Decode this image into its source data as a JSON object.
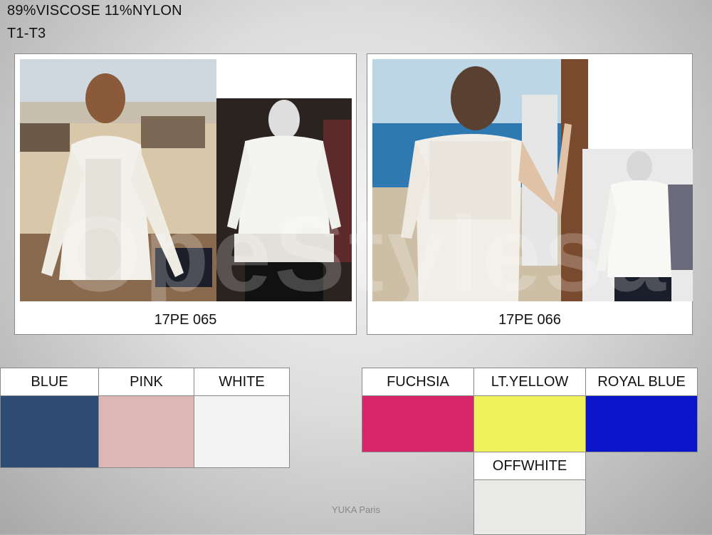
{
  "header": {
    "line1": "89%VISCOSE 11%NYLON",
    "line2": "T1-T3"
  },
  "products": [
    {
      "code": "17PE 065"
    },
    {
      "code": "17PE 066"
    }
  ],
  "watermark": "OpeStylesa",
  "swatches_left": [
    {
      "name": "BLUE",
      "color": "#2e4b74"
    },
    {
      "name": "PINK",
      "color": "#dcb7b5"
    },
    {
      "name": "WHITE",
      "color": "#f3f3f3"
    }
  ],
  "swatches_right": [
    {
      "name": "FUCHSIA",
      "color": "#d82468"
    },
    {
      "name": "LT.YELLOW",
      "color": "#eff359"
    },
    {
      "name": "ROYAL BLUE",
      "color": "#0a14c9"
    }
  ],
  "swatch_extra": {
    "name": "OFFWHITE",
    "color": "#e9e9e6"
  },
  "footer": "YUKA Paris"
}
